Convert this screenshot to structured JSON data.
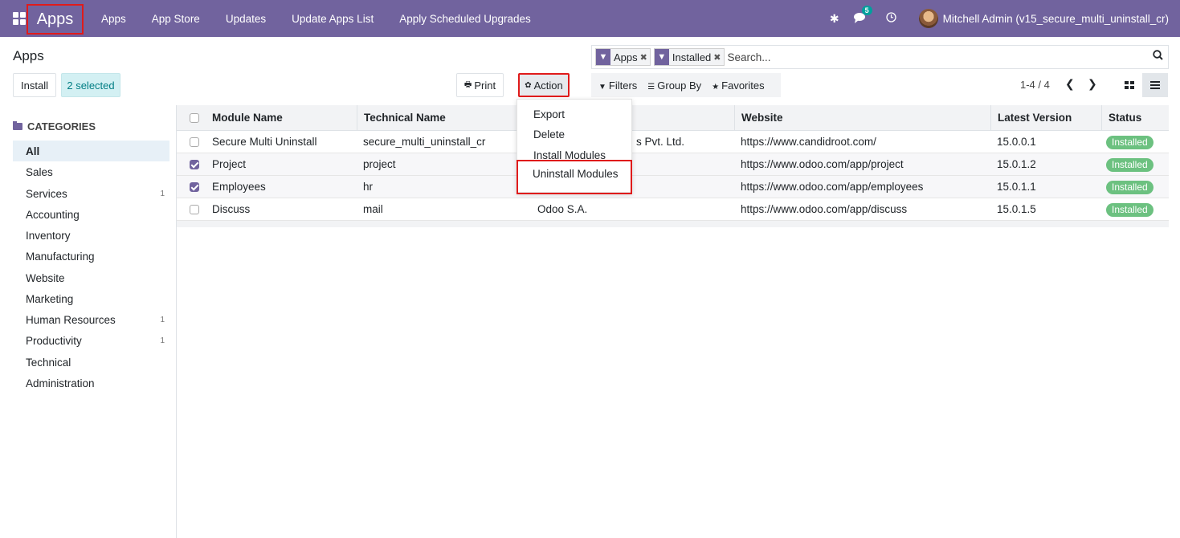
{
  "navbar": {
    "brand": "Apps",
    "menu": [
      "Apps",
      "App Store",
      "Updates",
      "Update Apps List",
      "Apply Scheduled Upgrades"
    ],
    "message_count": "5",
    "user_name": "Mitchell Admin (v15_secure_multi_uninstall_cr)",
    "icons": [
      "apps-grid-icon",
      "bug-icon",
      "chat-icon",
      "clock-icon"
    ],
    "color": "#71639e"
  },
  "control": {
    "breadcrumb": "Apps",
    "install_label": "Install",
    "selected_label": "2 selected",
    "print_label": "Print",
    "action_label": "Action",
    "action_menu": {
      "export": "Export",
      "delete": "Delete",
      "install": "Install Modules",
      "uninstall": "Uninstall Modules"
    },
    "search": {
      "facets": [
        "Apps",
        "Installed"
      ],
      "placeholder": "Search..."
    },
    "filters_label": "Filters",
    "groupby_label": "Group By",
    "favorites_label": "Favorites",
    "pager": "1-4 / 4"
  },
  "sidebar": {
    "heading": "CATEGORIES",
    "items": [
      {
        "label": "All",
        "count": ""
      },
      {
        "label": "Sales",
        "count": ""
      },
      {
        "label": "Services",
        "count": "1"
      },
      {
        "label": "Accounting",
        "count": ""
      },
      {
        "label": "Inventory",
        "count": ""
      },
      {
        "label": "Manufacturing",
        "count": ""
      },
      {
        "label": "Website",
        "count": ""
      },
      {
        "label": "Marketing",
        "count": ""
      },
      {
        "label": "Human Resources",
        "count": "1"
      },
      {
        "label": "Productivity",
        "count": "1"
      },
      {
        "label": "Technical",
        "count": ""
      },
      {
        "label": "Administration",
        "count": ""
      }
    ]
  },
  "table": {
    "headers": {
      "module": "Module Name",
      "technical": "Technical Name",
      "website": "Website",
      "version": "Latest Version",
      "status": "Status"
    },
    "rows": [
      {
        "module": "Secure Multi Uninstall",
        "technical": "secure_multi_uninstall_cr",
        "author": "s Pvt. Ltd.",
        "website": "https://www.candidroot.com/",
        "version": "15.0.0.1",
        "status": "Installed"
      },
      {
        "module": "Project",
        "technical": "project",
        "author": "",
        "website": "https://www.odoo.com/app/project",
        "version": "15.0.1.2",
        "status": "Installed"
      },
      {
        "module": "Employees",
        "technical": "hr",
        "author": "",
        "website": "https://www.odoo.com/app/employees",
        "version": "15.0.1.1",
        "status": "Installed"
      },
      {
        "module": "Discuss",
        "technical": "mail",
        "author": "Odoo S.A.",
        "website": "https://www.odoo.com/app/discuss",
        "version": "15.0.1.5",
        "status": "Installed"
      }
    ]
  }
}
